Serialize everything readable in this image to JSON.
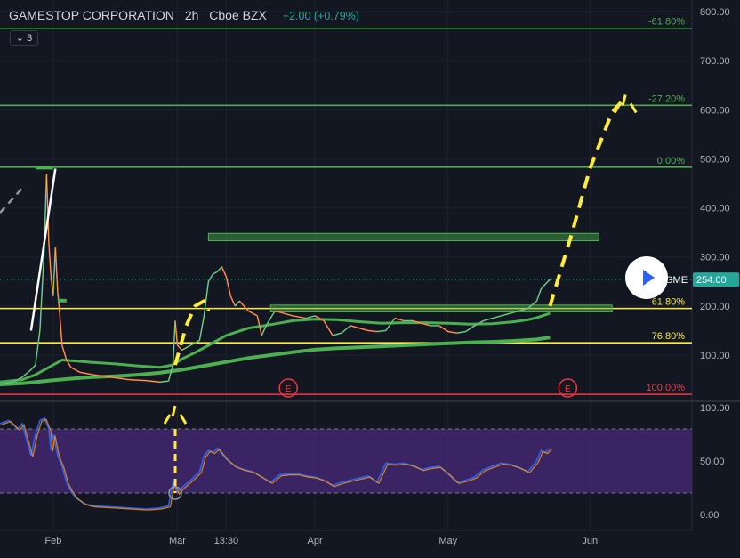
{
  "header": {
    "symbol_name": "GAMESTOP CORPORATION",
    "interval": "2h",
    "exchange": "Cboe BZX",
    "change": "+2.00 (+0.79%)",
    "indicator_count": "3"
  },
  "colors": {
    "background": "#131722",
    "up": "#26a69a",
    "down": "#ef5350",
    "fib_green": "#4caf50",
    "fib_yellow": "#ffeb3b",
    "fib_red": "#f23645",
    "rsi_band": "#4a2a7a",
    "price_label": "#26a69a"
  },
  "chart_data": [
    {
      "type": "line",
      "title": "",
      "price_axis": {
        "ticks": [
          "800.00",
          "700.00",
          "600.00",
          "500.00",
          "400.00",
          "300.00",
          "200.00",
          "100.00"
        ],
        "tick_values": [
          800,
          700,
          600,
          500,
          400,
          300,
          200,
          100
        ],
        "ylim": [
          30,
          815
        ]
      },
      "time_axis": {
        "ticks": [
          "Feb",
          "Mar",
          "13:30",
          "Apr",
          "May",
          "Jun"
        ],
        "tick_positions_days": [
          31,
          59,
          70,
          90,
          120,
          152
        ]
      },
      "xlim_days": [
        19,
        175
      ],
      "price_label": {
        "symbol": "GME",
        "value": "254.00",
        "numeric": 254
      },
      "fib_levels": [
        {
          "label": "-61.80%",
          "value": 766,
          "color": "#4caf50"
        },
        {
          "label": "-27.20%",
          "value": 609,
          "color": "#4caf50"
        },
        {
          "label": "0.00%",
          "value": 483,
          "color": "#4caf50"
        },
        {
          "label": "61.80%",
          "value": 195,
          "color": "#ffeb3b"
        },
        {
          "label": "76.80%",
          "value": 125,
          "color": "#ffeb3b"
        },
        {
          "label": "100.00%",
          "value": 20,
          "color": "#f23645"
        }
      ],
      "zones": [
        {
          "x0": 66,
          "x1": 154,
          "y0": 333,
          "y1": 348
        },
        {
          "x0": 80,
          "x1": 157,
          "y0": 188,
          "y1": 202
        }
      ],
      "earnings_markers": [
        {
          "day": 84,
          "label": "E"
        },
        {
          "day": 147,
          "label": "E"
        }
      ],
      "price_series": [
        [
          19,
          40
        ],
        [
          22,
          45
        ],
        [
          24,
          55
        ],
        [
          26,
          70
        ],
        [
          27,
          80
        ],
        [
          28,
          150
        ],
        [
          29,
          320
        ],
        [
          29.5,
          470
        ],
        [
          30,
          330
        ],
        [
          30.5,
          260
        ],
        [
          31,
          220
        ],
        [
          31.5,
          320
        ],
        [
          32,
          230
        ],
        [
          32.5,
          180
        ],
        [
          33,
          120
        ],
        [
          34,
          90
        ],
        [
          35,
          75
        ],
        [
          37,
          65
        ],
        [
          40,
          60
        ],
        [
          44,
          55
        ],
        [
          48,
          50
        ],
        [
          52,
          48
        ],
        [
          55,
          45
        ],
        [
          57,
          47
        ],
        [
          58,
          80
        ],
        [
          58.5,
          170
        ],
        [
          59,
          120
        ],
        [
          60,
          110
        ],
        [
          62,
          120
        ],
        [
          64,
          130
        ],
        [
          65,
          180
        ],
        [
          66,
          250
        ],
        [
          67,
          265
        ],
        [
          68,
          270
        ],
        [
          69,
          280
        ],
        [
          70,
          260
        ],
        [
          71,
          220
        ],
        [
          72,
          200
        ],
        [
          73,
          210
        ],
        [
          75,
          190
        ],
        [
          77,
          180
        ],
        [
          78,
          140
        ],
        [
          79,
          160
        ],
        [
          80,
          175
        ],
        [
          81,
          190
        ],
        [
          83,
          185
        ],
        [
          85,
          180
        ],
        [
          88,
          175
        ],
        [
          90,
          180
        ],
        [
          92,
          170
        ],
        [
          94,
          140
        ],
        [
          96,
          145
        ],
        [
          98,
          160
        ],
        [
          100,
          155
        ],
        [
          102,
          150
        ],
        [
          104,
          148
        ],
        [
          106,
          150
        ],
        [
          108,
          175
        ],
        [
          110,
          170
        ],
        [
          112,
          170
        ],
        [
          114,
          165
        ],
        [
          116,
          160
        ],
        [
          118,
          160
        ],
        [
          120,
          148
        ],
        [
          122,
          145
        ],
        [
          124,
          148
        ],
        [
          126,
          160
        ],
        [
          128,
          170
        ],
        [
          130,
          175
        ],
        [
          132,
          180
        ],
        [
          134,
          185
        ],
        [
          136,
          190
        ],
        [
          138,
          195
        ],
        [
          140,
          210
        ],
        [
          141,
          235
        ],
        [
          142,
          245
        ],
        [
          143,
          254
        ]
      ],
      "ma_fast": [
        [
          19,
          45
        ],
        [
          24,
          50
        ],
        [
          27,
          60
        ],
        [
          30,
          75
        ],
        [
          33,
          90
        ],
        [
          36,
          88
        ],
        [
          40,
          85
        ],
        [
          45,
          82
        ],
        [
          50,
          78
        ],
        [
          55,
          75
        ],
        [
          58,
          80
        ],
        [
          60,
          92
        ],
        [
          63,
          105
        ],
        [
          66,
          120
        ],
        [
          70,
          140
        ],
        [
          75,
          155
        ],
        [
          80,
          162
        ],
        [
          85,
          170
        ],
        [
          90,
          173
        ],
        [
          95,
          172
        ],
        [
          100,
          168
        ],
        [
          105,
          165
        ],
        [
          110,
          166
        ],
        [
          115,
          166
        ],
        [
          120,
          165
        ],
        [
          125,
          163
        ],
        [
          130,
          164
        ],
        [
          135,
          168
        ],
        [
          138,
          172
        ],
        [
          140,
          176
        ],
        [
          143,
          185
        ]
      ],
      "ma_slow": [
        [
          19,
          40
        ],
        [
          25,
          43
        ],
        [
          30,
          48
        ],
        [
          35,
          52
        ],
        [
          40,
          55
        ],
        [
          45,
          57
        ],
        [
          50,
          60
        ],
        [
          55,
          64
        ],
        [
          60,
          70
        ],
        [
          65,
          78
        ],
        [
          70,
          86
        ],
        [
          75,
          94
        ],
        [
          80,
          100
        ],
        [
          85,
          106
        ],
        [
          90,
          111
        ],
        [
          95,
          114
        ],
        [
          100,
          116
        ],
        [
          105,
          118
        ],
        [
          110,
          120
        ],
        [
          115,
          122
        ],
        [
          120,
          124
        ],
        [
          125,
          126
        ],
        [
          130,
          127
        ],
        [
          135,
          129
        ],
        [
          140,
          132
        ],
        [
          143,
          136
        ]
      ],
      "annotations": [
        {
          "kind": "white-line",
          "points": [
            [
              26,
              150
            ],
            [
              31.5,
              480
            ]
          ]
        },
        {
          "kind": "grey-dashed",
          "points": [
            [
              19,
              390
            ],
            [
              24,
              440
            ]
          ]
        },
        {
          "kind": "yellow-dashed",
          "points": [
            [
              58.5,
              80
            ],
            [
              61,
              160
            ],
            [
              63,
              200
            ],
            [
              65,
              210
            ],
            [
              66,
              190
            ]
          ]
        },
        {
          "kind": "yellow-dashed",
          "points": [
            [
              143,
              200
            ],
            [
              148,
              350
            ],
            [
              152,
              480
            ],
            [
              157,
              595
            ],
            [
              160,
              625
            ]
          ]
        },
        {
          "kind": "yellow-sparkle",
          "at": [
            160,
            605
          ]
        },
        {
          "kind": "green-marker",
          "points": [
            [
              27,
              482
            ],
            [
              31,
              482
            ]
          ]
        },
        {
          "kind": "green-marker",
          "points": [
            [
              32,
              211
            ],
            [
              34,
              211
            ]
          ]
        }
      ]
    },
    {
      "type": "line",
      "title": "",
      "panel": "rsi",
      "ticks": [
        "100.00",
        "50.00",
        "0.00"
      ],
      "tick_values": [
        100,
        50,
        0
      ],
      "ylim": [
        -20,
        105
      ],
      "band": [
        20,
        80
      ],
      "series": [
        {
          "values": [
            [
              19,
              85
            ],
            [
              21,
              88
            ],
            [
              23,
              80
            ],
            [
              24,
              85
            ],
            [
              25,
              70
            ],
            [
              26,
              55
            ],
            [
              27,
              75
            ],
            [
              28,
              88
            ],
            [
              29,
              90
            ],
            [
              30,
              80
            ],
            [
              30.5,
              60
            ],
            [
              31,
              75
            ],
            [
              32,
              55
            ],
            [
              33,
              45
            ],
            [
              34,
              30
            ],
            [
              35,
              22
            ],
            [
              36,
              16
            ],
            [
              38,
              10
            ],
            [
              40,
              8
            ],
            [
              44,
              7
            ],
            [
              48,
              6
            ],
            [
              52,
              5
            ],
            [
              55,
              6
            ],
            [
              57,
              8
            ],
            [
              58,
              30
            ],
            [
              59,
              20
            ],
            [
              60,
              25
            ],
            [
              62,
              32
            ],
            [
              64,
              40
            ],
            [
              65,
              55
            ],
            [
              66,
              60
            ],
            [
              67,
              58
            ],
            [
              68,
              62
            ],
            [
              70,
              52
            ],
            [
              72,
              45
            ],
            [
              74,
              42
            ],
            [
              76,
              40
            ],
            [
              78,
              35
            ],
            [
              80,
              30
            ],
            [
              82,
              37
            ],
            [
              84,
              38
            ],
            [
              86,
              38
            ],
            [
              88,
              36
            ],
            [
              90,
              35
            ],
            [
              92,
              32
            ],
            [
              94,
              27
            ],
            [
              96,
              30
            ],
            [
              98,
              32
            ],
            [
              100,
              34
            ],
            [
              102,
              36
            ],
            [
              104,
              30
            ],
            [
              106,
              48
            ],
            [
              108,
              47
            ],
            [
              110,
              48
            ],
            [
              112,
              46
            ],
            [
              114,
              42
            ],
            [
              116,
              44
            ],
            [
              118,
              45
            ],
            [
              120,
              38
            ],
            [
              122,
              30
            ],
            [
              124,
              32
            ],
            [
              126,
              35
            ],
            [
              128,
              42
            ],
            [
              130,
              45
            ],
            [
              132,
              48
            ],
            [
              134,
              47
            ],
            [
              136,
              44
            ],
            [
              138,
              40
            ],
            [
              140,
              50
            ],
            [
              141,
              60
            ],
            [
              142,
              58
            ],
            [
              143,
              62
            ]
          ]
        }
      ],
      "annotations": [
        {
          "kind": "yellow-dashed-vertical",
          "at": [
            58.5,
            20
          ]
        },
        {
          "kind": "yellow-sparkle",
          "at": [
            58.5,
            90
          ]
        }
      ]
    }
  ]
}
